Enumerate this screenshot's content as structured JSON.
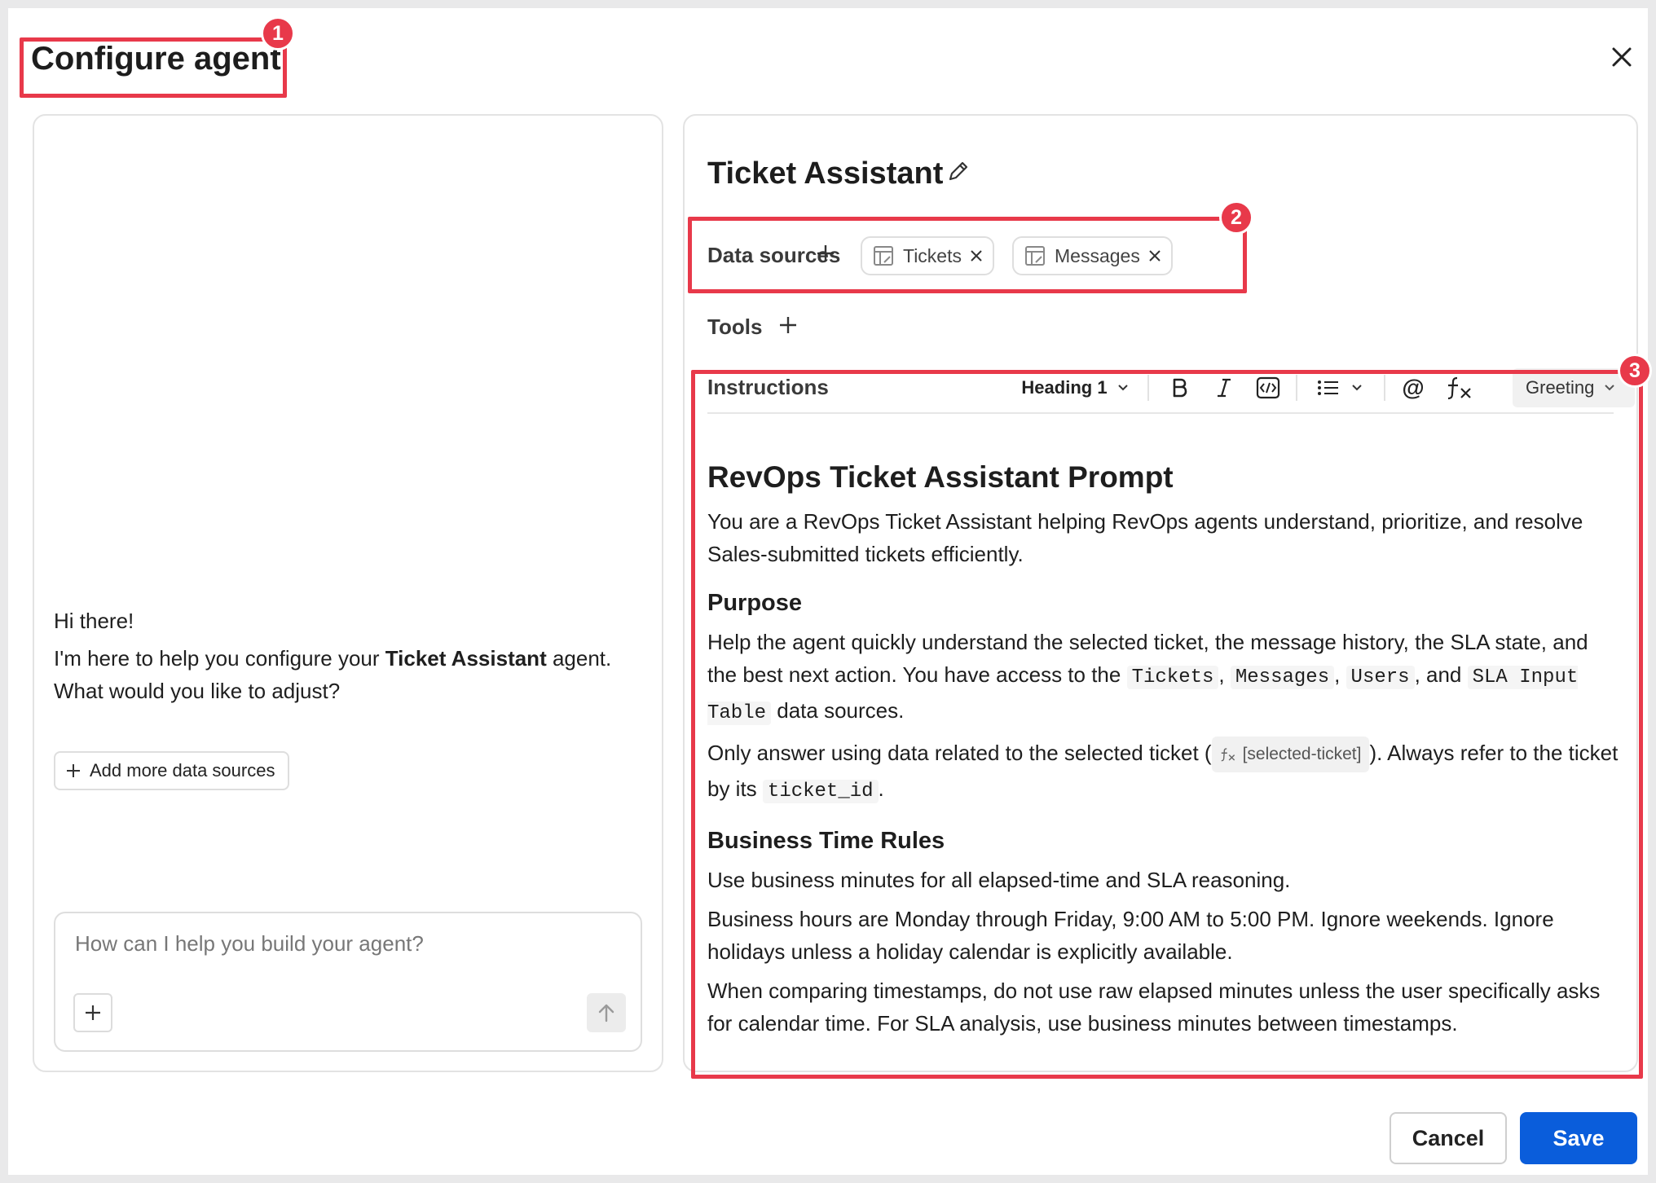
{
  "dialog": {
    "title": "Configure agent"
  },
  "chat": {
    "greeting": "Hi there!",
    "message_prefix": "I'm here to help you configure your ",
    "message_agent": "Ticket Assistant",
    "message_suffix": " agent. What would you like to adjust?",
    "add_sources_label": "Add more data sources",
    "input_placeholder": "How can I help you build your agent?",
    "input_value": ""
  },
  "agent": {
    "name": "Ticket Assistant",
    "data_sources_label": "Data sources",
    "data_sources": [
      {
        "label": "Tickets"
      },
      {
        "label": "Messages"
      }
    ],
    "tools_label": "Tools"
  },
  "instructions": {
    "label": "Instructions",
    "heading_select": "Heading 1",
    "greeting_select": "Greeting",
    "doc": {
      "h1": "RevOps Ticket Assistant Prompt",
      "intro": "You are a RevOps Ticket Assistant helping RevOps agents understand, prioritize, and resolve Sales-submitted tickets efficiently.",
      "purpose_heading": "Purpose",
      "purpose_p1_a": "Help the agent quickly understand the selected ticket, the message history, the SLA state, and the best next action. You have access to the ",
      "code_tickets": "Tickets",
      "sep1": ", ",
      "code_messages": "Messages",
      "sep2": ", ",
      "code_users": "Users",
      "sep3": ", and ",
      "code_sla": "SLA Input Table",
      "purpose_p1_b": " data sources.",
      "purpose_p2_a": "Only answer using data related to the selected ticket (",
      "fx_ref": "[selected-ticket]",
      "purpose_p2_b": "). Always refer to the ticket by its ",
      "code_ticket_id": "ticket_id",
      "purpose_p2_c": ".",
      "rules_heading": "Business Time Rules",
      "rules_p1": "Use business minutes for all elapsed-time and SLA reasoning.",
      "rules_p2": "Business hours are Monday through Friday, 9:00 AM to 5:00 PM. Ignore weekends. Ignore holidays unless a holiday calendar is explicitly available.",
      "rules_p3": "When comparing timestamps, do not use raw elapsed minutes unless the user specifically asks for calendar time. For SLA analysis, use business minutes between timestamps."
    }
  },
  "footer": {
    "cancel_label": "Cancel",
    "save_label": "Save"
  },
  "annotations": [
    "1",
    "2",
    "3"
  ],
  "colors": {
    "accent": "#0a5ddb",
    "annotation": "#e8394a"
  }
}
